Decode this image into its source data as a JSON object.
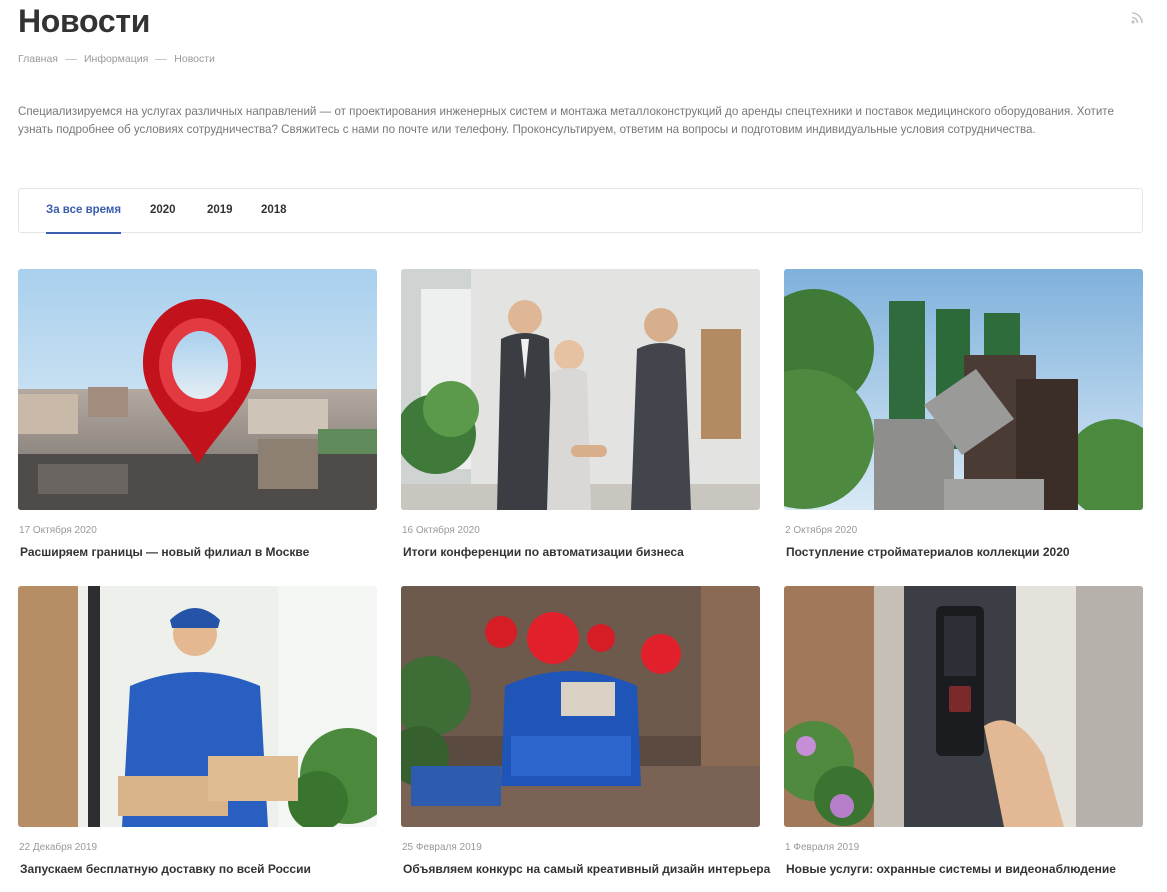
{
  "page": {
    "title": "Новости"
  },
  "breadcrumb": [
    "Главная",
    "Информация",
    "Новости"
  ],
  "intro": "Специализируемся на услугах различных направлений — от проектирования инженерных систем и монтажа металлоконструкций до аренды спецтехники и поставок медицинского оборудования. Хотите узнать подробнее об условиях сотрудничества? Свяжитесь с нами по почте или телефону. Проконсультируем, ответим на вопросы и подготовим индивидуальные условия сотрудничества.",
  "tabs": [
    {
      "label": "За все время",
      "active": true
    },
    {
      "label": "2020",
      "active": false
    },
    {
      "label": "2019",
      "active": false
    },
    {
      "label": "2018",
      "active": false
    }
  ],
  "news": [
    {
      "date": "17 Октября 2020",
      "title": "Расширяем границы — новый филиал в Москве",
      "image": "moscow-map-pin-image"
    },
    {
      "date": "16 Октября 2020",
      "title": "Итоги конференции по автоматизации бизнеса",
      "image": "business-handshake-image"
    },
    {
      "date": "2 Октября 2020",
      "title": "Поступление стройматериалов коллекции 2020",
      "image": "building-materials-image"
    },
    {
      "date": "22 Декабря 2019",
      "title": "Запускаем бесплатную доставку по всей России",
      "image": "courier-delivery-image"
    },
    {
      "date": "25 Февраля 2019",
      "title": "Объявляем конкурс на самый креативный дизайн интерьера",
      "image": "interior-armchair-balloons-image"
    },
    {
      "date": "1 Февраля 2019",
      "title": "Новые услуги: охранные системы и видеонаблюдение",
      "image": "security-fingerprint-scanner-image"
    }
  ],
  "colors": {
    "accent": "#3a5dae",
    "text": "#333333",
    "muted": "#999999",
    "border": "#e5e5e5"
  },
  "icons": {
    "rss": "rss-icon"
  }
}
